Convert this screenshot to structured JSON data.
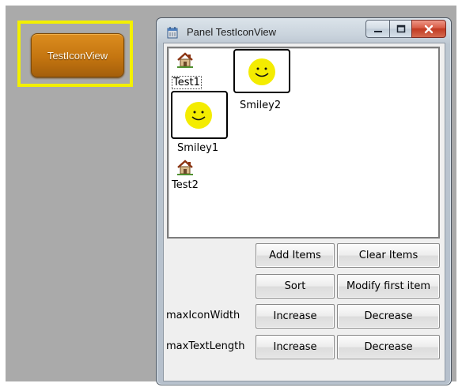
{
  "launcher": {
    "label": "TestIconView"
  },
  "window": {
    "title": "Panel TestIconView",
    "icon": "window-app-icon",
    "controls": [
      "minimize-icon",
      "maximize-icon",
      "close-icon"
    ]
  },
  "iconview": {
    "items": [
      {
        "label": "Test1",
        "icon": "house-icon"
      },
      {
        "label": "Smiley2",
        "icon": "smiley-icon"
      },
      {
        "label": "Smiley1",
        "icon": "smiley-icon"
      },
      {
        "label": "Test2",
        "icon": "house-icon"
      }
    ]
  },
  "controls": {
    "add_items": "Add Items",
    "clear_items": "Clear Items",
    "sort": "Sort",
    "modify_first_item": "Modify first item",
    "max_icon_width_label": "maxIconWidth",
    "max_text_length_label": "maxTextLength",
    "increase": "Increase",
    "decrease": "Decrease"
  },
  "colors": {
    "launcher_highlight": "#f3f000",
    "launcher_button": "#c47510",
    "smiley_face": "#f4ec00"
  }
}
